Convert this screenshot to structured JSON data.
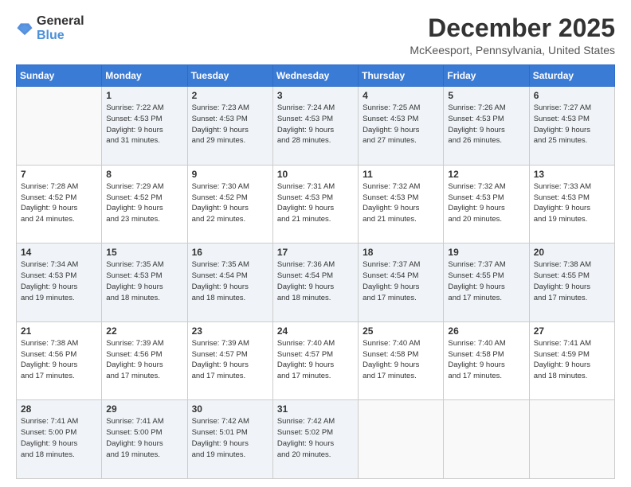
{
  "header": {
    "logo": {
      "general": "General",
      "blue": "Blue"
    },
    "title": "December 2025",
    "location": "McKeesport, Pennsylvania, United States"
  },
  "days_of_week": [
    "Sunday",
    "Monday",
    "Tuesday",
    "Wednesday",
    "Thursday",
    "Friday",
    "Saturday"
  ],
  "weeks": [
    [
      {
        "day": "",
        "sunrise": "",
        "sunset": "",
        "daylight": ""
      },
      {
        "day": "1",
        "sunrise": "Sunrise: 7:22 AM",
        "sunset": "Sunset: 4:53 PM",
        "daylight": "Daylight: 9 hours and 31 minutes."
      },
      {
        "day": "2",
        "sunrise": "Sunrise: 7:23 AM",
        "sunset": "Sunset: 4:53 PM",
        "daylight": "Daylight: 9 hours and 29 minutes."
      },
      {
        "day": "3",
        "sunrise": "Sunrise: 7:24 AM",
        "sunset": "Sunset: 4:53 PM",
        "daylight": "Daylight: 9 hours and 28 minutes."
      },
      {
        "day": "4",
        "sunrise": "Sunrise: 7:25 AM",
        "sunset": "Sunset: 4:53 PM",
        "daylight": "Daylight: 9 hours and 27 minutes."
      },
      {
        "day": "5",
        "sunrise": "Sunrise: 7:26 AM",
        "sunset": "Sunset: 4:53 PM",
        "daylight": "Daylight: 9 hours and 26 minutes."
      },
      {
        "day": "6",
        "sunrise": "Sunrise: 7:27 AM",
        "sunset": "Sunset: 4:53 PM",
        "daylight": "Daylight: 9 hours and 25 minutes."
      }
    ],
    [
      {
        "day": "7",
        "sunrise": "Sunrise: 7:28 AM",
        "sunset": "Sunset: 4:52 PM",
        "daylight": "Daylight: 9 hours and 24 minutes."
      },
      {
        "day": "8",
        "sunrise": "Sunrise: 7:29 AM",
        "sunset": "Sunset: 4:52 PM",
        "daylight": "Daylight: 9 hours and 23 minutes."
      },
      {
        "day": "9",
        "sunrise": "Sunrise: 7:30 AM",
        "sunset": "Sunset: 4:52 PM",
        "daylight": "Daylight: 9 hours and 22 minutes."
      },
      {
        "day": "10",
        "sunrise": "Sunrise: 7:31 AM",
        "sunset": "Sunset: 4:53 PM",
        "daylight": "Daylight: 9 hours and 21 minutes."
      },
      {
        "day": "11",
        "sunrise": "Sunrise: 7:32 AM",
        "sunset": "Sunset: 4:53 PM",
        "daylight": "Daylight: 9 hours and 21 minutes."
      },
      {
        "day": "12",
        "sunrise": "Sunrise: 7:32 AM",
        "sunset": "Sunset: 4:53 PM",
        "daylight": "Daylight: 9 hours and 20 minutes."
      },
      {
        "day": "13",
        "sunrise": "Sunrise: 7:33 AM",
        "sunset": "Sunset: 4:53 PM",
        "daylight": "Daylight: 9 hours and 19 minutes."
      }
    ],
    [
      {
        "day": "14",
        "sunrise": "Sunrise: 7:34 AM",
        "sunset": "Sunset: 4:53 PM",
        "daylight": "Daylight: 9 hours and 19 minutes."
      },
      {
        "day": "15",
        "sunrise": "Sunrise: 7:35 AM",
        "sunset": "Sunset: 4:53 PM",
        "daylight": "Daylight: 9 hours and 18 minutes."
      },
      {
        "day": "16",
        "sunrise": "Sunrise: 7:35 AM",
        "sunset": "Sunset: 4:54 PM",
        "daylight": "Daylight: 9 hours and 18 minutes."
      },
      {
        "day": "17",
        "sunrise": "Sunrise: 7:36 AM",
        "sunset": "Sunset: 4:54 PM",
        "daylight": "Daylight: 9 hours and 18 minutes."
      },
      {
        "day": "18",
        "sunrise": "Sunrise: 7:37 AM",
        "sunset": "Sunset: 4:54 PM",
        "daylight": "Daylight: 9 hours and 17 minutes."
      },
      {
        "day": "19",
        "sunrise": "Sunrise: 7:37 AM",
        "sunset": "Sunset: 4:55 PM",
        "daylight": "Daylight: 9 hours and 17 minutes."
      },
      {
        "day": "20",
        "sunrise": "Sunrise: 7:38 AM",
        "sunset": "Sunset: 4:55 PM",
        "daylight": "Daylight: 9 hours and 17 minutes."
      }
    ],
    [
      {
        "day": "21",
        "sunrise": "Sunrise: 7:38 AM",
        "sunset": "Sunset: 4:56 PM",
        "daylight": "Daylight: 9 hours and 17 minutes."
      },
      {
        "day": "22",
        "sunrise": "Sunrise: 7:39 AM",
        "sunset": "Sunset: 4:56 PM",
        "daylight": "Daylight: 9 hours and 17 minutes."
      },
      {
        "day": "23",
        "sunrise": "Sunrise: 7:39 AM",
        "sunset": "Sunset: 4:57 PM",
        "daylight": "Daylight: 9 hours and 17 minutes."
      },
      {
        "day": "24",
        "sunrise": "Sunrise: 7:40 AM",
        "sunset": "Sunset: 4:57 PM",
        "daylight": "Daylight: 9 hours and 17 minutes."
      },
      {
        "day": "25",
        "sunrise": "Sunrise: 7:40 AM",
        "sunset": "Sunset: 4:58 PM",
        "daylight": "Daylight: 9 hours and 17 minutes."
      },
      {
        "day": "26",
        "sunrise": "Sunrise: 7:40 AM",
        "sunset": "Sunset: 4:58 PM",
        "daylight": "Daylight: 9 hours and 17 minutes."
      },
      {
        "day": "27",
        "sunrise": "Sunrise: 7:41 AM",
        "sunset": "Sunset: 4:59 PM",
        "daylight": "Daylight: 9 hours and 18 minutes."
      }
    ],
    [
      {
        "day": "28",
        "sunrise": "Sunrise: 7:41 AM",
        "sunset": "Sunset: 5:00 PM",
        "daylight": "Daylight: 9 hours and 18 minutes."
      },
      {
        "day": "29",
        "sunrise": "Sunrise: 7:41 AM",
        "sunset": "Sunset: 5:00 PM",
        "daylight": "Daylight: 9 hours and 19 minutes."
      },
      {
        "day": "30",
        "sunrise": "Sunrise: 7:42 AM",
        "sunset": "Sunset: 5:01 PM",
        "daylight": "Daylight: 9 hours and 19 minutes."
      },
      {
        "day": "31",
        "sunrise": "Sunrise: 7:42 AM",
        "sunset": "Sunset: 5:02 PM",
        "daylight": "Daylight: 9 hours and 20 minutes."
      },
      {
        "day": "",
        "sunrise": "",
        "sunset": "",
        "daylight": ""
      },
      {
        "day": "",
        "sunrise": "",
        "sunset": "",
        "daylight": ""
      },
      {
        "day": "",
        "sunrise": "",
        "sunset": "",
        "daylight": ""
      }
    ]
  ]
}
